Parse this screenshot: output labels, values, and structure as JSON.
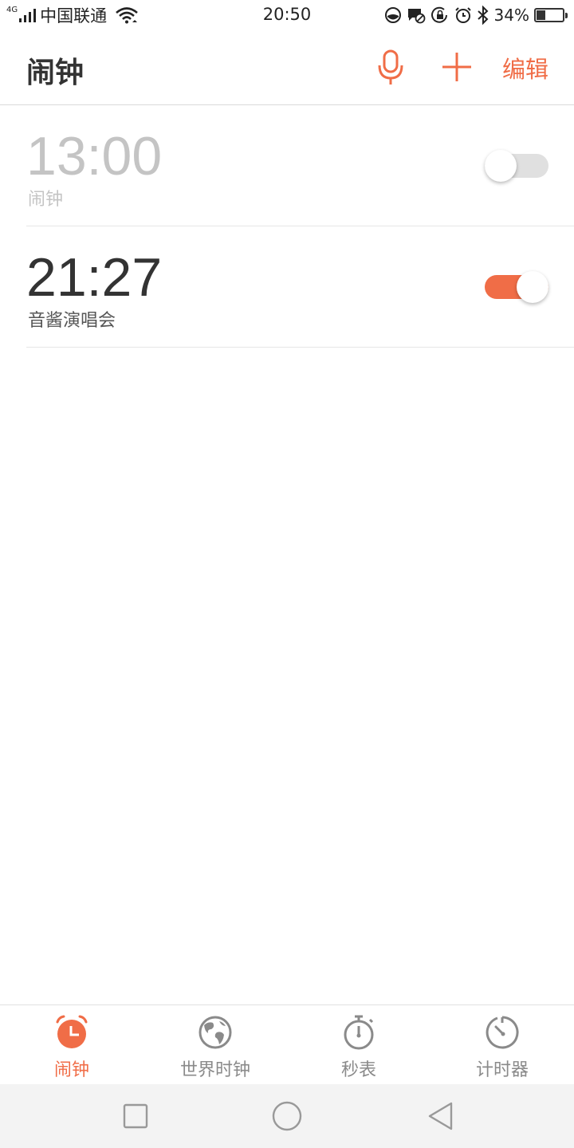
{
  "status_bar": {
    "network_type": "4G",
    "carrier": "中国联通",
    "time": "20:50",
    "battery_percent": "34%",
    "battery_level": 0.34,
    "icons": [
      "signal-icon",
      "wifi-icon",
      "data-saver-icon",
      "message-blocked-icon",
      "rotation-lock-icon",
      "alarm-icon",
      "bluetooth-icon",
      "battery-icon"
    ]
  },
  "header": {
    "title": "闹钟",
    "edit_label": "编辑"
  },
  "alarms": [
    {
      "time": "13:00",
      "label": "闹钟",
      "enabled": false
    },
    {
      "time": "21:27",
      "label": "音酱演唱会",
      "enabled": true
    }
  ],
  "tabs": [
    {
      "label": "闹钟",
      "icon": "alarm-clock-icon",
      "active": true
    },
    {
      "label": "世界时钟",
      "icon": "globe-icon",
      "active": false
    },
    {
      "label": "秒表",
      "icon": "stopwatch-icon",
      "active": false
    },
    {
      "label": "计时器",
      "icon": "timer-icon",
      "active": false
    }
  ],
  "colors": {
    "accent": "#f06d47",
    "text_primary": "#333333",
    "text_disabled": "#c4c4c4",
    "tab_inactive": "#8a8a8a",
    "nav_background": "#f3f3f3"
  }
}
